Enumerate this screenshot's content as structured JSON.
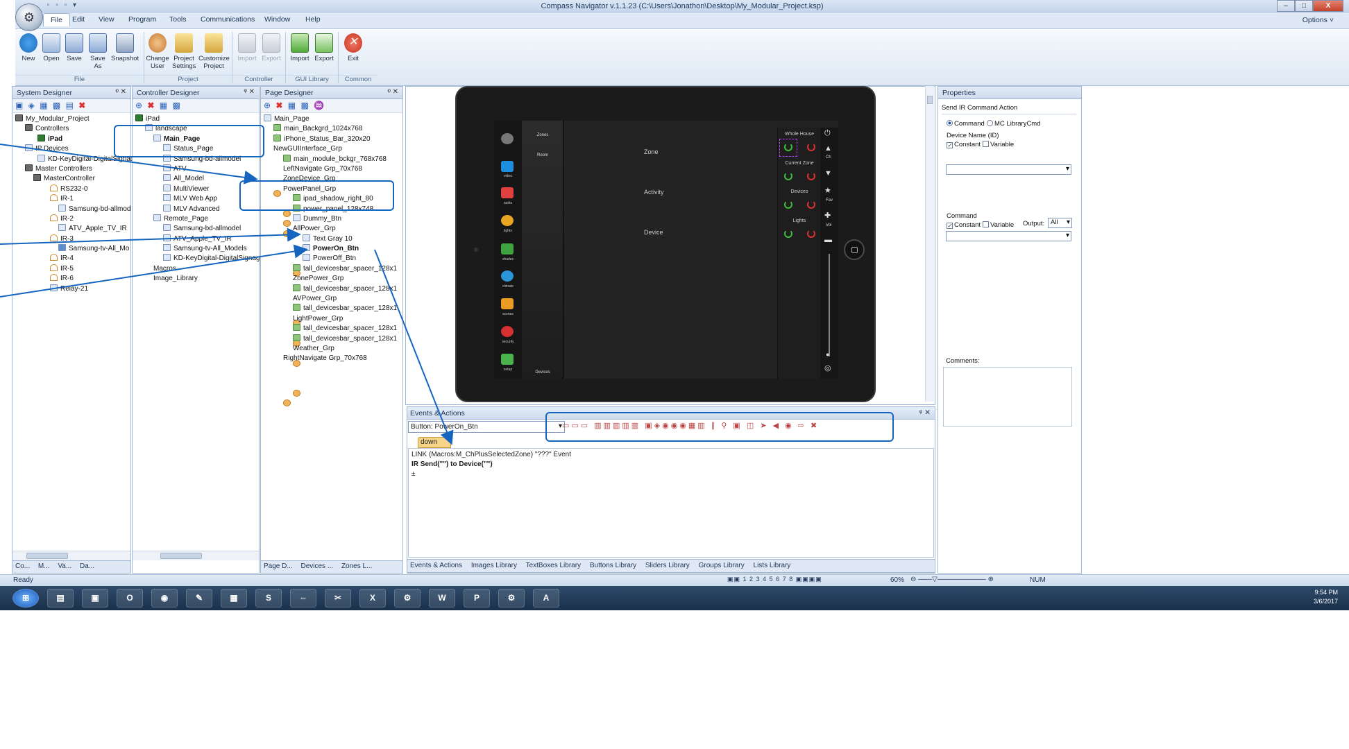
{
  "window": {
    "title": "Compass Navigator  v.1.1.23 (C:\\Users\\Jonathon\\Desktop\\My_Modular_Project.ksp)",
    "min": "–",
    "max": "□",
    "close": "X"
  },
  "menu": {
    "items": [
      "File",
      "Edit",
      "View",
      "Program",
      "Tools",
      "Communications",
      "Window",
      "Help"
    ],
    "options": "Options ˅"
  },
  "ribbon": {
    "file": [
      "New",
      "Open",
      "Save",
      "Save As",
      "Snapshot"
    ],
    "project": [
      "Change User",
      "Project Settings",
      "Customize Project"
    ],
    "controller": [
      "Import",
      "Export"
    ],
    "gui": [
      "Import",
      "Export"
    ],
    "common": [
      "Exit"
    ],
    "groups": [
      "File",
      "Project",
      "Controller",
      "GUI Library",
      "Common"
    ]
  },
  "system_designer": {
    "title": "System Designer",
    "tree": [
      "My_Modular_Project",
      "Controllers",
      "iPad",
      "IP Devices",
      "KD-KeyDigital-DigitalSignag",
      "Master Controllers",
      "MasterController",
      "RS232-0",
      "IR-1",
      "Samsung-bd-allmod",
      "IR-2",
      "ATV_Apple_TV_IR",
      "IR-3",
      "Samsung-tv-All_Mo",
      "IR-4",
      "IR-5",
      "IR-6",
      "Relay-21"
    ],
    "tabs": [
      "Co...",
      "M...",
      "Va...",
      "Da..."
    ]
  },
  "controller_designer": {
    "title": "Controller Designer",
    "tree": [
      "iPad",
      "landscape",
      "Main_Page",
      "Status_Page",
      "Samsung-bd-allmodel",
      "ATV",
      "All_Model",
      "MultiViewer",
      "MLV Web App",
      "MLV Advanced",
      "Remote_Page",
      "Samsung-bd-allmodel",
      "ATV_Apple_TV_IR",
      "Samsung-tv-All_Models",
      "KD-KeyDigital-DigitalSignag",
      "Macros",
      "Image_Library"
    ]
  },
  "page_designer": {
    "title": "Page Designer",
    "tree": [
      "Main_Page",
      "main_Backgrd_1024x768",
      "iPhone_Status_Bar_320x20",
      "NewGUIInterface_Grp",
      "main_module_bckgr_768x768",
      "LeftNavigate Grp_70x768",
      "ZoneDevice_Grp",
      "PowerPanel_Grp",
      "ipad_shadow_right_80",
      "power_panel_128x748",
      "Dummy_Btn",
      "AllPower_Grp",
      "Text Gray 10",
      "PowerOn_Btn",
      "PowerOff_Btn",
      "tall_devicesbar_spacer_128x1",
      "ZonePower_Grp",
      "tall_devicesbar_spacer_128x1",
      "AVPower_Grp",
      "tall_devicesbar_spacer_128x1",
      "LightPower_Grp",
      "tall_devicesbar_spacer_128x1",
      "tall_devicesbar_spacer_128x1",
      "Weather_Grp",
      "RightNavigate Grp_70x768"
    ],
    "tabs": [
      "Page D...",
      "Devices ...",
      "Zones L..."
    ]
  },
  "ipad": {
    "left_icons": [
      "video",
      "audio",
      "lights",
      "shades",
      "climate",
      "scenes",
      "security",
      "setup"
    ],
    "nav": [
      "Zones",
      "Room",
      "Devices"
    ],
    "content": [
      "Zone",
      "Activity",
      "Device"
    ],
    "power_labels": [
      "Whole House",
      "Current Zone",
      "Devices",
      "Lights"
    ],
    "ctrl": [
      "Ch",
      "Fav",
      "Vol"
    ]
  },
  "properties": {
    "title": "Properties",
    "heading": "Send IR Command Action",
    "radio_command": "Command",
    "radio_mc": "MC LibraryCmd",
    "device_name": "Device Name (ID)",
    "constant": "Constant",
    "variable": "Variable",
    "command_label": "Command",
    "output_label": "Output:",
    "output_value": "All",
    "comments": "Comments:"
  },
  "events": {
    "title": "Events & Actions",
    "button_combo": "Button: PowerOn_Btn",
    "tab": "down",
    "rows": [
      "LINK   (Macros:M_ChPlusSelectedZone) \"???\" Event",
      "IR  Send(\"\") to Device(\"\")",
      "±"
    ],
    "tabs": [
      "Events & Actions",
      "Images Library",
      "TextBoxes Library",
      "Buttons Library",
      "Sliders Library",
      "Groups Library",
      "Lists Library"
    ]
  },
  "status": {
    "left": "Ready",
    "zoom": "60%",
    "num": "NUM",
    "pages": [
      "1",
      "2",
      "3",
      "4",
      "5",
      "6",
      "7",
      "8"
    ]
  },
  "taskbar": {
    "time": "9:54 PM",
    "date": "3/6/2017"
  }
}
